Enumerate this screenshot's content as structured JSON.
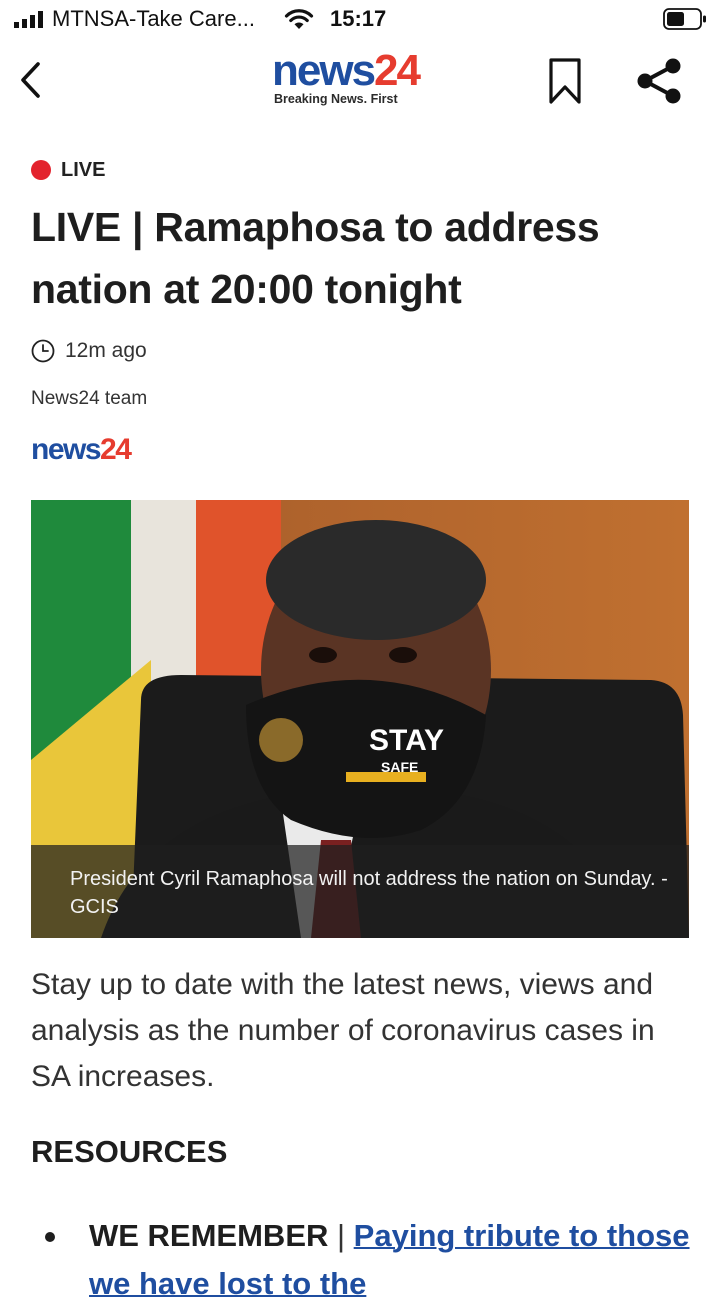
{
  "status_bar": {
    "carrier": "MTNSA-Take Care...",
    "time": "15:17",
    "icons": [
      "signal-icon",
      "wifi-icon",
      "battery-icon"
    ]
  },
  "nav": {
    "back_icon": "chevron-left-icon",
    "logo": {
      "word_part1": "news",
      "word_part2": "24",
      "tagline": "Breaking News. First"
    },
    "bookmark_icon": "bookmark-icon",
    "share_icon": "share-icon"
  },
  "article": {
    "live_label": "LIVE",
    "headline": "LIVE | Ramaphosa to address nation at 20:00 tonight",
    "time_ago": "12m ago",
    "author": "News24 team",
    "source_logo": {
      "part1": "news",
      "part2": "24"
    },
    "image_caption": "President Cyril Ramaphosa will not address the nation on Sunday.  - GCIS",
    "intro": "Stay up to date with the latest news, views and analysis as the number of coronavirus cases in SA increases.",
    "resources_heading": "RESOURCES",
    "resources": [
      {
        "bold": "WE REMEMBER",
        "separator": " | ",
        "link": "Paying tribute to those we have lost to the"
      }
    ]
  },
  "colors": {
    "brand_blue": "#1f4ea0",
    "brand_red": "#e63c2f",
    "live_red": "#e3232d"
  }
}
